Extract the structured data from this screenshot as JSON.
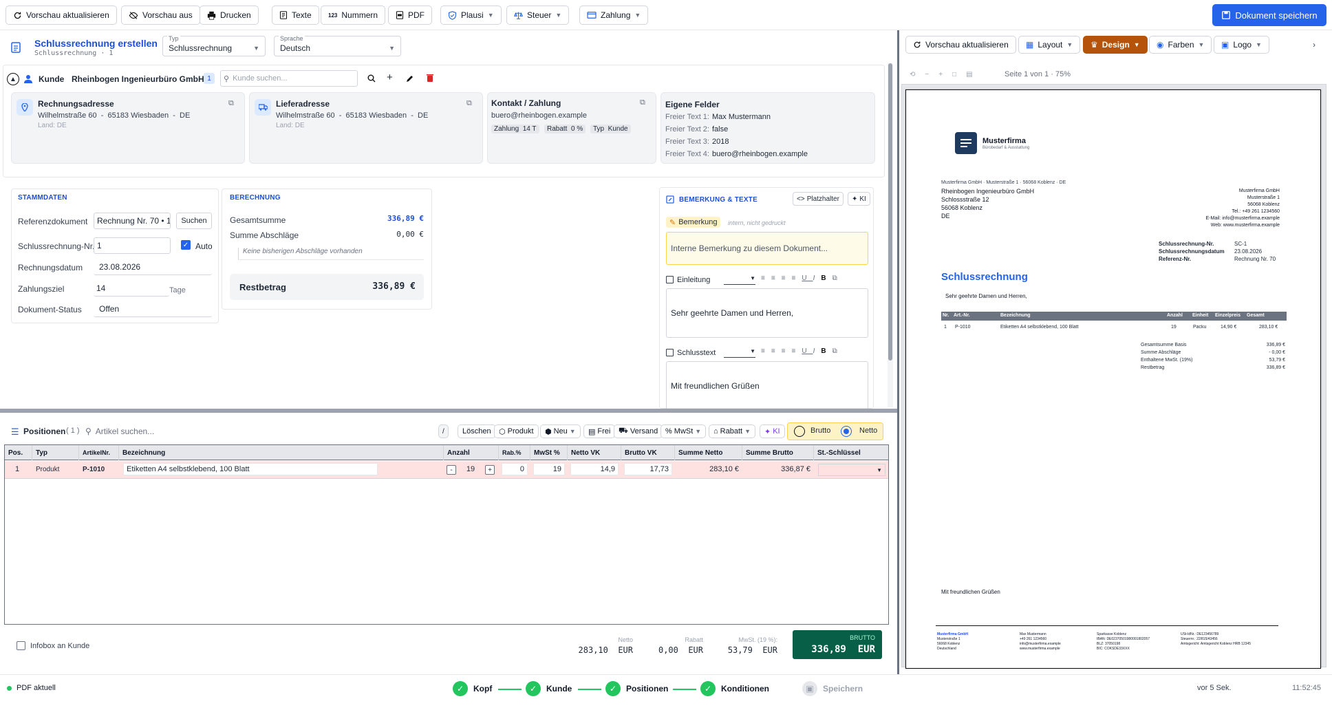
{
  "toolbar": {
    "refresh": "Vorschau aktualisieren",
    "preview_off": "Vorschau aus",
    "print": "Drucken",
    "texts": "Texte",
    "numbers": "Nummern",
    "numbers_badge": "123",
    "pdf": "PDF",
    "plausi": "Plausi",
    "tax": "Steuer",
    "payment": "Zahlung",
    "save": "Dokument speichern"
  },
  "doc": {
    "title": "Schlussrechnung erstellen",
    "subtitle": "Schlussrechnung · 1",
    "type_label": "Typ",
    "type_value": "Schlussrechnung",
    "lang_label": "Sprache",
    "lang_value": "Deutsch"
  },
  "customer": {
    "label": "Kunde",
    "name": "Rheinbogen Ingenieurbüro GmbH",
    "count": "1",
    "search_placeholder": "Kunde suchen...",
    "billing": {
      "title": "Rechnungsadresse",
      "line": "Wilhelmstraße 60  -  65183 Wiesbaden  -  DE",
      "country": "Land: DE"
    },
    "delivery": {
      "title": "Lieferadresse",
      "line": "Wilhelmstraße 60  -  65183 Wiesbaden  -  DE",
      "country": "Land: DE"
    },
    "contact": {
      "title": "Kontakt / Zahlung",
      "email": "buero@rheinbogen.example",
      "chip1": "Zahlung  14 T",
      "chip2": "Rabatt  0 %",
      "chip3": "Typ  Kunde"
    },
    "custom": {
      "title": "Eigene Felder",
      "rows": [
        {
          "k": "Freier Text 1:",
          "v": "Max Mustermann"
        },
        {
          "k": "Freier Text 2:",
          "v": "false"
        },
        {
          "k": "Freier Text 3:",
          "v": "2018"
        },
        {
          "k": "Freier Text 4:",
          "v": "buero@rheinbogen.example"
        }
      ]
    }
  },
  "stamm": {
    "title": "STAMMDATEN",
    "ref_label": "Referenzdokument",
    "ref_value": "Rechnung Nr. 70 • 19",
    "search_btn": "Suchen",
    "nr_label": "Schlussrechnung-Nr.",
    "nr_value": "1",
    "auto": "Auto",
    "date_label": "Rechnungsdatum",
    "date_value": "23.08.2026",
    "term_label": "Zahlungsziel",
    "term_value": "14",
    "term_unit": "Tage",
    "status_label": "Dokument-Status",
    "status_value": "Offen"
  },
  "calc": {
    "title": "BERECHNUNG",
    "total_label": "Gesamtsumme",
    "total_value": "336,89 €",
    "deduct_label": "Summe Abschläge",
    "deduct_value": "0,00 €",
    "empty_note": "Keine bisherigen Abschläge vorhanden",
    "rest_label": "Restbetrag",
    "rest_value": "336,89 €"
  },
  "remarks": {
    "title": "BEMERKUNG & TEXTE",
    "placeholder_btn": "Platzhalter",
    "ai_btn": "KI",
    "remark_label": "Bemerkung",
    "remark_note": "intern, nicht gedruckt",
    "remark_placeholder": "Interne Bemerkung zu diesem Dokument...",
    "intro_label": "Einleitung",
    "intro_text": "Sehr geehrte Damen und Herren,",
    "closing_label": "Schlusstext",
    "closing_text": "Mit freundlichen Grüßen"
  },
  "positions": {
    "title": "Positionen",
    "count": "( 1 )",
    "search_placeholder": "Artikel suchen...",
    "slash": "/",
    "delete": "Löschen",
    "product": "Produkt",
    "new": "Neu",
    "free": "Frei",
    "shipping": "Versand",
    "vat": "MwSt",
    "discount": "Rabatt",
    "ai": "KI",
    "gross": "Brutto",
    "net": "Netto",
    "columns": [
      "Pos.",
      "Typ",
      "ArtikelNr.",
      "Bezeichnung",
      "Anzahl",
      "Rab.%",
      "MwSt %",
      "Netto VK",
      "Brutto VK",
      "Summe Netto",
      "Summe Brutto",
      "St.-Schlüssel"
    ],
    "rows": [
      {
        "pos": "1",
        "type": "Produkt",
        "art": "P-1010",
        "desc": "Etiketten A4 selbstklebend, 100 Blatt",
        "qty": "19",
        "disc": "0",
        "vat": "19",
        "net": "14,9",
        "gross": "17,73",
        "sum_net": "283,10 €",
        "sum_gross": "336,87 €"
      }
    ]
  },
  "footer": {
    "infobox": "Infobox an Kunde",
    "net_label": "Netto",
    "net_value": "283,10  EUR",
    "disc_label": "Rabatt",
    "disc_value": "0,00  EUR",
    "vat_label": "MwSt. (19 %):",
    "vat_value": "53,79  EUR",
    "gross_label": "BRUTTO",
    "gross_value": "336,89  EUR"
  },
  "steps": {
    "status": "PDF aktuell",
    "items": [
      "Kopf",
      "Kunde",
      "Positionen",
      "Konditionen",
      "Speichern"
    ],
    "time_ago": "vor 5 Sek.",
    "time": "11:52:45"
  },
  "preview": {
    "refresh": "Vorschau aktualisieren",
    "layout": "Layout",
    "design": "Design",
    "colors": "Farben",
    "logo": "Logo",
    "page_info": "Seite 1 von 1 · 75%",
    "accent": "#b45309",
    "pdf": {
      "company": "Musterfirma",
      "tagline": "Bürobedarf & Ausstattung",
      "sender_line": "Musterfirma GmbH · Musterstraße 1 · 56068 Koblenz · DE",
      "recipient": [
        "Rheinbogen Ingenieurbüro GmbH",
        "Schlossstraße 12",
        "56068 Koblenz",
        "DE"
      ],
      "company_block": [
        "Musterfirma GmbH",
        "Musterstraße 1",
        "56068 Koblenz",
        "Tel.: +49 261 1234560",
        "E-Mail: info@musterfirma.example",
        "Web: www.musterfirma.example"
      ],
      "meta": [
        {
          "k": "Schlussrechnung-Nr.",
          "v": "SC-1"
        },
        {
          "k": "Schlussrechnungsdatum",
          "v": "23.08.2026"
        },
        {
          "k": "Referenz-Nr.",
          "v": "Rechnung Nr. 70"
        }
      ],
      "heading": "Schlussrechnung",
      "salutation": "Sehr geehrte Damen und Herren,",
      "table_head": [
        "Nr.",
        "Art.-Nr.",
        "Bezeichnung",
        "Anzahl",
        "Einheit",
        "Einzelpreis",
        "Gesamt"
      ],
      "table_row": [
        "1",
        "P-1010",
        "Etiketten A4 selbstklebend, 100 Blatt",
        "19",
        "Packu",
        "14,90 €",
        "283,10 €"
      ],
      "totals": [
        {
          "k": "Gesamtsumme Basis",
          "v": "336,89 €"
        },
        {
          "k": "Summe Abschläge",
          "v": "- 0,00 €"
        },
        {
          "k": "Enthaltene MwSt. (19%)",
          "v": "53,79 €"
        },
        {
          "k": "Restbetrag",
          "v": "336,89 €"
        }
      ],
      "closing": "Mit freundlichen Grüßen",
      "footer_col1": [
        "Musterfirma GmbH",
        "Musterstraße 1",
        "56068 Koblenz",
        "Deutschland"
      ],
      "footer_col2": [
        "Max Mustermann",
        "+49 261 1234560",
        "info@musterfirma.example",
        "www.musterfirma.example"
      ],
      "footer_col3": [
        "Sparkasse Koblenz",
        "IBAN: DE02370501980001802057",
        "BLZ: 37050198",
        "BIC: COKSDE33XXX"
      ],
      "footer_col4": [
        "USt-IdNr.: DE123456789",
        "Steuernr.: 22/815/43456",
        "Amtsgericht: Amtsgericht Koblenz HRB 12345"
      ]
    }
  },
  "colors": {
    "primary": "#1d4ed8",
    "save": "#2563eb",
    "design": "#b45309",
    "success": "#22c55e",
    "brutto_box": "#065f46"
  }
}
